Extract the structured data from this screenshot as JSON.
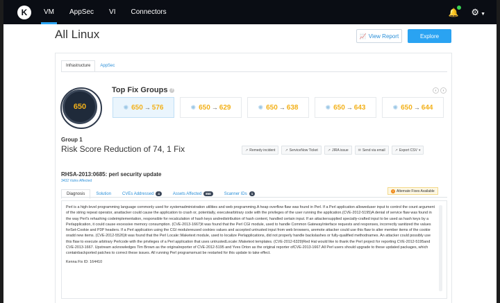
{
  "nav": {
    "logo": "K",
    "items": [
      "VM",
      "AppSec",
      "VI",
      "Connectors"
    ],
    "active": "VM"
  },
  "header": {
    "title": "All Linux",
    "view_report": "View Report",
    "explore": "Explore"
  },
  "tabs_top": [
    "Infrastructure",
    "AppSec"
  ],
  "score": "650",
  "top_fix": {
    "title": "Top Fix Groups",
    "groups": [
      {
        "from": "650",
        "to": "576"
      },
      {
        "from": "650",
        "to": "629"
      },
      {
        "from": "650",
        "to": "638"
      },
      {
        "from": "650",
        "to": "643"
      },
      {
        "from": "650",
        "to": "644"
      }
    ]
  },
  "group": {
    "label": "Group 1",
    "title": "Risk Score Reduction of 74, 1 Fix",
    "actions": [
      "Remedy incident",
      "ServiceNow Ticket",
      "JIRA issue",
      "Send via email",
      "Export CSV"
    ]
  },
  "fix": {
    "title": "RHSA-2013:0685: perl security update",
    "vulns": "3432 Vulns Affected",
    "tabs": {
      "diagnosis": "Diagnosis",
      "solution": "Solution",
      "cves": "CVEs Addressed",
      "cves_count": "4",
      "assets": "Assets Affected",
      "assets_count": "858",
      "scanner": "Scanner IDs",
      "scanner_count": "1"
    },
    "alt_fixes": "Alternate Fixes Available",
    "description": "Perl is a high-level programming language commonly used for systemadministration utilities and web programming.A heap overflow flaw was found in Perl. If a Perl application alloweduser input to control the count argument of the string repeat operator, anattacker could cause the application to crash or, potentially, executearbitrary code with the privileges of the user running the application.(CVE-2012-5195)A denial of service flaw was found in the way Perl's rehashing codeimplementation, responsible for recalculation of hash keys andredistribution of hash content, handled certain input. If an attackersupplied specially-crafted input to be used as hash keys by a Perlapplication, it could cause excessive memory consumption. (CVE-2013-1667)It was found that the Perl CGI module, used to handle Common GatewayInterface requests and responses, incorrectly sanitized the values forSet-Cookie and P3P headers. If a Perl application using the CGI modulereused cookies values and accepted untrusted input from web browsers, aremote attacker could use this flaw to alter member items of the cookie oradd new items. (CVE-2012-5526)It was found that the Perl Locale::Maketext module, used to localize Perlapplications, did not properly handle backslashes or fully-qualified methodnames. An attacker could possibly use this flaw to execute arbitrary Perlcode with the privileges of a Perl application that uses untrustedLocale::Maketext templates. (CVE-2012-6329)Red Hat would like to thank the Perl project for reporting CVE-2012-5195and CVE-2013-1667. Upstream acknowledges Tim Brown as the originalreporter of CVE-2012-5195 and Yves Orton as the original reporter ofCVE-2013-1667.All Perl users should upgrade to these updated packages, which containbackported patches to correct these issues. All running Perl programsmust be restarted for this update to take effect.",
    "kenna_id": "Kenna Fix ID: 164410"
  }
}
